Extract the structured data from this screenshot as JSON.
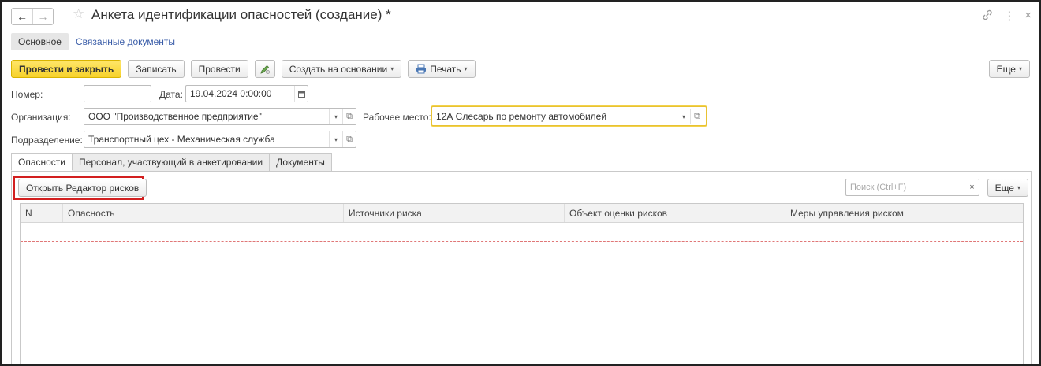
{
  "window": {
    "title": "Анкета идентификации опасностей (создание) *",
    "back_icon": "←",
    "forward_icon": "→",
    "star_icon": "☆",
    "link_icon": "🔗",
    "menu_icon": "⋮",
    "close_icon": "×"
  },
  "sections": {
    "main": "Основное",
    "related": "Связанные документы"
  },
  "toolbar": {
    "post_close": "Провести и закрыть",
    "save": "Записать",
    "post": "Провести",
    "create_based": "Создать на основании",
    "print": "Печать",
    "more": "Еще"
  },
  "form": {
    "number_label": "Номер:",
    "number_value": "",
    "date_label": "Дата:",
    "date_value": "19.04.2024  0:00:00",
    "org_label": "Организация:",
    "org_value": "ООО \"Производственное предприятие\"",
    "workplace_label": "Рабочее место:",
    "workplace_value": "12А Слесарь по ремонту автомобилей",
    "division_label": "Подразделение:",
    "division_value": "Транспортный цех - Механическая служба"
  },
  "tabs": [
    {
      "label": "Опасности"
    },
    {
      "label": "Персонал, участвующий в анкетировании"
    },
    {
      "label": "Документы"
    }
  ],
  "panel": {
    "open_editor": "Открыть Редактор рисков",
    "search_placeholder": "Поиск (Ctrl+F)",
    "more": "Еще"
  },
  "table": {
    "columns": [
      "N",
      "Опасность",
      "Источники риска",
      "Объект оценки рисков",
      "Меры управления риском"
    ]
  },
  "colors": {
    "primary_button": "#f7d22a",
    "highlight_box": "#d21f1f",
    "focus_border": "#e8c233",
    "link": "#3a5da8"
  }
}
